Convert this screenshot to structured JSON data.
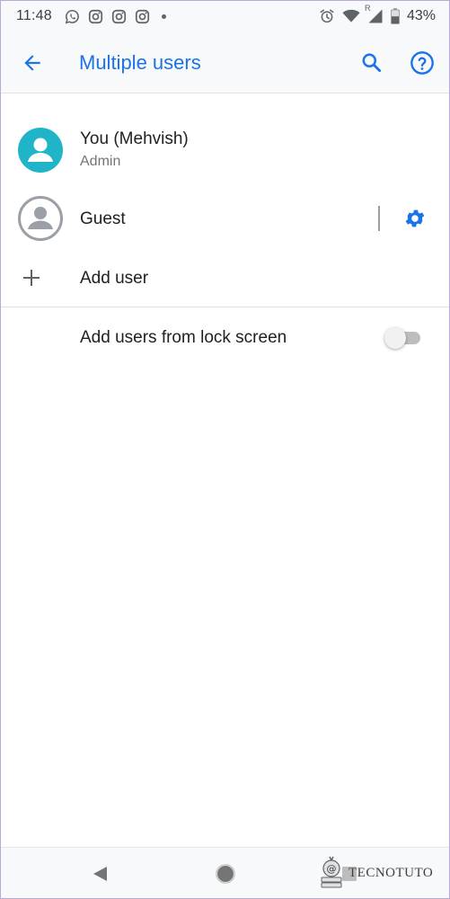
{
  "status_bar": {
    "time": "11:48",
    "notifications": [
      "whatsapp-icon",
      "instagram-icon",
      "instagram-icon",
      "instagram-icon"
    ],
    "battery_percent": "43%",
    "signal_roaming": "R"
  },
  "app_bar": {
    "title": "Multiple users",
    "accent_color": "#1a73e8"
  },
  "users": [
    {
      "name": "You (Mehvish)",
      "role": "Admin",
      "avatar_color": "#20b4c8"
    },
    {
      "name": "Guest"
    }
  ],
  "add_user": {
    "label": "Add user"
  },
  "settings": {
    "lock_screen_label": "Add users from lock screen",
    "lock_screen_enabled": false
  },
  "watermark": {
    "text": "TECNOTUTO"
  }
}
